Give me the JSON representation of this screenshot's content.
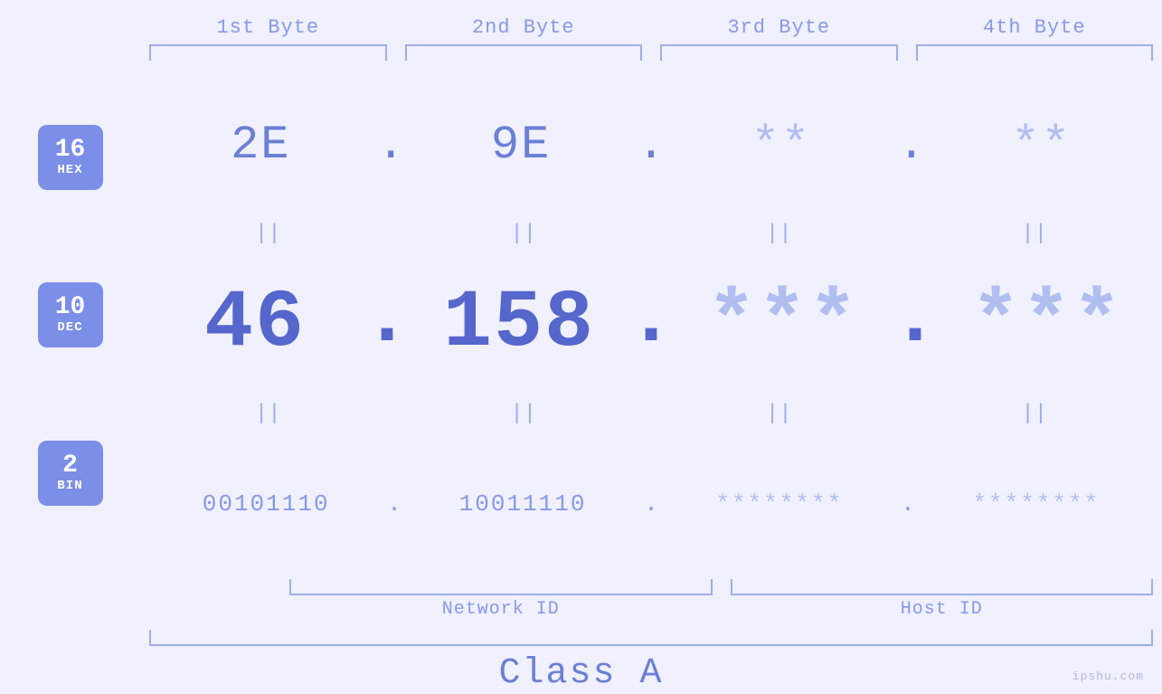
{
  "header": {
    "byte1": "1st Byte",
    "byte2": "2nd Byte",
    "byte3": "3rd Byte",
    "byte4": "4th Byte"
  },
  "badges": {
    "hex": {
      "num": "16",
      "label": "HEX"
    },
    "dec": {
      "num": "10",
      "label": "DEC"
    },
    "bin": {
      "num": "2",
      "label": "BIN"
    }
  },
  "hex_row": {
    "b1": "2E",
    "b2": "9E",
    "b3": "**",
    "b4": "**",
    "dot": "."
  },
  "dec_row": {
    "b1": "46",
    "b2": "158",
    "b3": "***",
    "b4": "***",
    "dot": "."
  },
  "bin_row": {
    "b1": "00101110",
    "b2": "10011110",
    "b3": "********",
    "b4": "********",
    "dot": "."
  },
  "labels": {
    "network_id": "Network ID",
    "host_id": "Host ID",
    "class": "Class A"
  },
  "watermark": "ipshu.com"
}
